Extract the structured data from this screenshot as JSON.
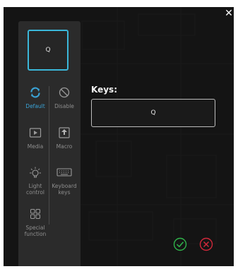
{
  "dialog": {
    "close_glyph": "✕",
    "preview_key": "Q",
    "keys_label": "Keys:",
    "key_value": "Q"
  },
  "options": [
    {
      "label": "Default",
      "icon": "refresh-icon",
      "active": true
    },
    {
      "label": "Disable",
      "icon": "disable-icon",
      "active": false
    },
    {
      "label": "Media",
      "icon": "media-icon",
      "active": false
    },
    {
      "label": "Macro",
      "icon": "macro-icon",
      "active": false
    },
    {
      "label": "Light control",
      "icon": "light-bulb-icon",
      "active": false
    },
    {
      "label": "Keyboard keys",
      "icon": "keyboard-icon",
      "active": false
    },
    {
      "label": "Special function",
      "icon": "special-function-icon",
      "active": false
    }
  ],
  "colors": {
    "accent": "#3aa3d6",
    "confirm": "#2fb34a",
    "cancel": "#d0283a"
  }
}
